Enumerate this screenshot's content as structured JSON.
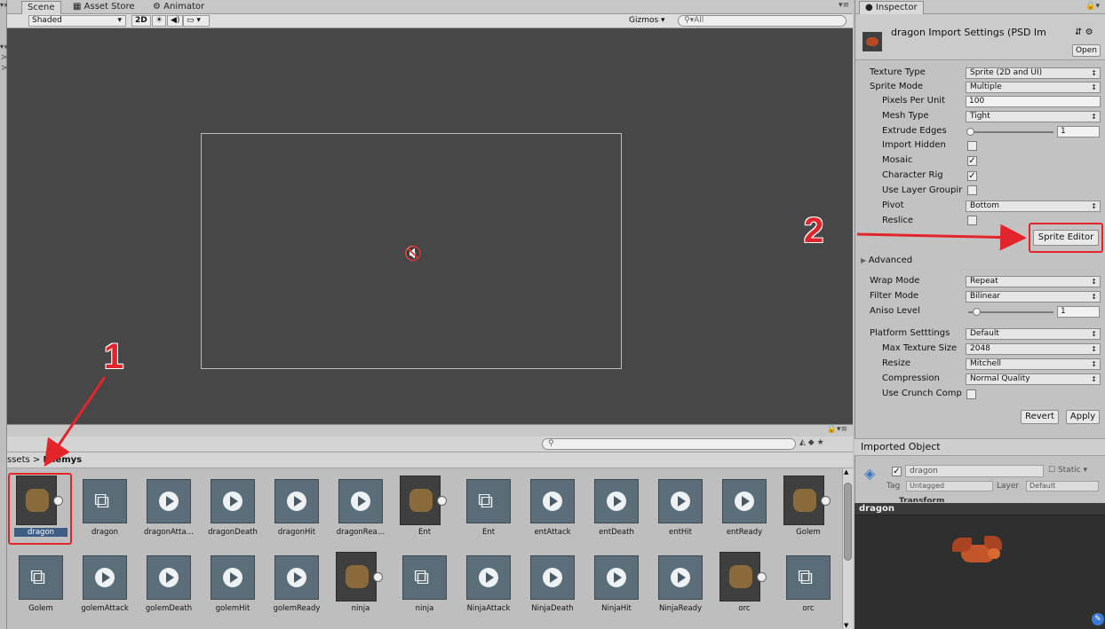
{
  "scene_panel": {
    "tabs": [
      "Scene",
      "Asset Store",
      "Animator"
    ],
    "tab_icons": [
      "scene-icon",
      "asset-store-icon",
      "animator-icon"
    ],
    "shading_mode": "Shaded",
    "mode_2d": "2D",
    "gizmos_label": "Gizmos",
    "search_value": "All"
  },
  "project": {
    "breadcrumb_root": "ssets",
    "breadcrumb_sep": ">",
    "breadcrumb_current": "Enemys",
    "assets_row1": [
      {
        "name": "dragon",
        "type": "image"
      },
      {
        "name": "dragon",
        "type": "controller"
      },
      {
        "name": "dragonAtta…",
        "type": "clip"
      },
      {
        "name": "dragonDeath",
        "type": "clip"
      },
      {
        "name": "dragonHit",
        "type": "clip"
      },
      {
        "name": "dragonRea…",
        "type": "clip"
      },
      {
        "name": "Ent",
        "type": "image"
      },
      {
        "name": "Ent",
        "type": "controller"
      },
      {
        "name": "entAttack",
        "type": "clip"
      },
      {
        "name": "entDeath",
        "type": "clip"
      },
      {
        "name": "entHit",
        "type": "clip"
      },
      {
        "name": "entReady",
        "type": "clip"
      },
      {
        "name": "Golem",
        "type": "image"
      }
    ],
    "assets_row2": [
      {
        "name": "Golem",
        "type": "controller"
      },
      {
        "name": "golemAttack",
        "type": "clip"
      },
      {
        "name": "golemDeath",
        "type": "clip"
      },
      {
        "name": "golemHit",
        "type": "clip"
      },
      {
        "name": "golemReady",
        "type": "clip"
      },
      {
        "name": "ninja",
        "type": "image"
      },
      {
        "name": "ninja",
        "type": "controller"
      },
      {
        "name": "NinjaAttack",
        "type": "clip"
      },
      {
        "name": "NinjaDeath",
        "type": "clip"
      },
      {
        "name": "NinjaHit",
        "type": "clip"
      },
      {
        "name": "NinjaReady",
        "type": "clip"
      },
      {
        "name": "orc",
        "type": "image"
      },
      {
        "name": "orc",
        "type": "controller"
      }
    ]
  },
  "inspector": {
    "tab_label": "Inspector",
    "title": "dragon Import Settings (PSD Im",
    "open_button": "Open",
    "fields": {
      "texture_type": {
        "label": "Texture Type",
        "value": "Sprite (2D and UI)"
      },
      "sprite_mode": {
        "label": "Sprite Mode",
        "value": "Multiple"
      },
      "pixels_per_unit": {
        "label": "Pixels Per Unit",
        "value": "100"
      },
      "mesh_type": {
        "label": "Mesh Type",
        "value": "Tight"
      },
      "extrude_edges": {
        "label": "Extrude Edges",
        "value": "1",
        "slider_fraction": 0.0
      },
      "import_hidden": {
        "label": "Import Hidden",
        "checked": false
      },
      "mosaic": {
        "label": "Mosaic",
        "checked": true
      },
      "character_rig": {
        "label": "Character Rig",
        "checked": true
      },
      "use_layer_grouping": {
        "label": "Use Layer Groupir",
        "checked": false
      },
      "pivot": {
        "label": "Pivot",
        "value": "Bottom"
      },
      "reslice": {
        "label": "Reslice",
        "checked": false
      }
    },
    "sprite_editor_button": "Sprite Editor",
    "advanced_label": "Advanced",
    "wrap_mode": {
      "label": "Wrap Mode",
      "value": "Repeat"
    },
    "filter_mode": {
      "label": "Filter Mode",
      "value": "Bilinear"
    },
    "aniso_level": {
      "label": "Aniso Level",
      "value": "1",
      "slider_fraction": 0.1
    },
    "platform_settings": {
      "label": "Platform Setttings",
      "value": "Default"
    },
    "max_texture_size": {
      "label": "Max Texture Size",
      "value": "2048"
    },
    "resize": {
      "label": "Resize",
      "value": "Mitchell"
    },
    "compression": {
      "label": "Compression",
      "value": "Normal Quality"
    },
    "use_crunch": {
      "label": "Use Crunch Comp",
      "checked": false
    },
    "revert_button": "Revert",
    "apply_button": "Apply",
    "imported_object_label": "Imported Object",
    "object_name": "dragon",
    "static_label": "Static",
    "tag_label": "Tag",
    "tag_value": "Untagged",
    "layer_label": "Layer",
    "layer_value": "Default",
    "transform_label": "Transform",
    "preview_label": "dragon"
  },
  "annotations": {
    "step1": "1",
    "step2": "2"
  },
  "colors": {
    "highlight": "#e2252b",
    "scene_bg": "#474747",
    "selection": "#3d5d84"
  }
}
